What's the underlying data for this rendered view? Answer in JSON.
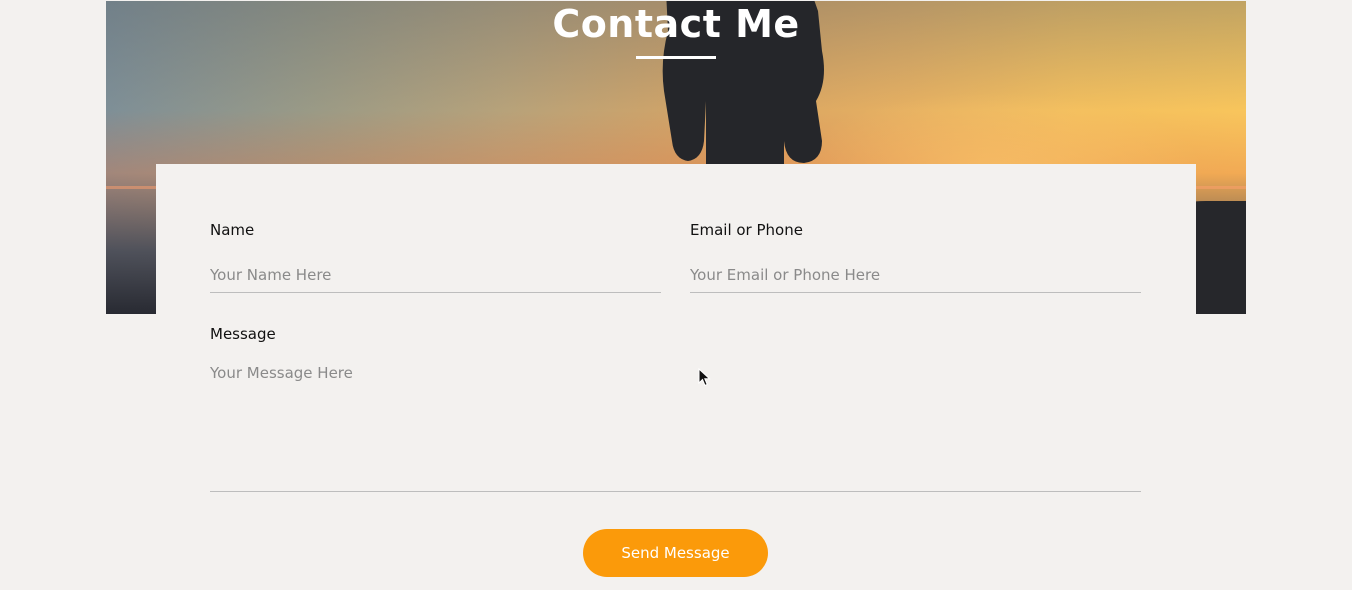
{
  "header": {
    "title": "Contact Me"
  },
  "form": {
    "name_label": "Name",
    "name_placeholder": "Your Name Here",
    "contact_label": "Email or Phone",
    "contact_placeholder": "Your Email or Phone Here",
    "message_label": "Message",
    "message_placeholder": "Your Message Here",
    "submit_label": "Send Message"
  },
  "colors": {
    "accent": "#fb9a0a",
    "background": "#f3f1ef",
    "title_text": "#ffffff"
  },
  "icons": {
    "cursor": "mouse-pointer-icon"
  }
}
